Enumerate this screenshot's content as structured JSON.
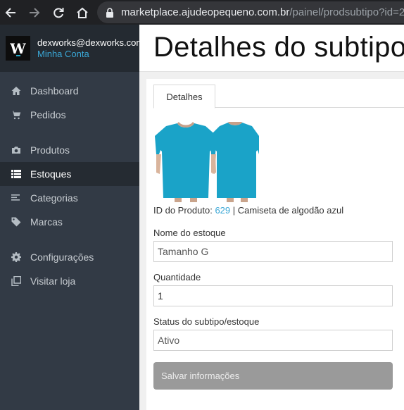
{
  "browser": {
    "url_host": "marketplace.ajudeopequeno.com.br",
    "url_path": "/painel/prodsubtipo?id=2"
  },
  "sidebar": {
    "logo_letter": "W",
    "user_email": "dexworks@dexworks.com",
    "account_link": "Minha Conta",
    "items": [
      {
        "label": "Dashboard",
        "icon": "home-icon",
        "active": false
      },
      {
        "label": "Pedidos",
        "icon": "cart-icon",
        "active": false
      },
      {
        "label": "Produtos",
        "icon": "camera-icon",
        "active": false
      },
      {
        "label": "Estoques",
        "icon": "list-icon",
        "active": true
      },
      {
        "label": "Categorias",
        "icon": "lines-icon",
        "active": false
      },
      {
        "label": "Marcas",
        "icon": "tag-icon",
        "active": false
      },
      {
        "label": "Configurações",
        "icon": "gear-icon",
        "active": false
      },
      {
        "label": "Visitar loja",
        "icon": "external-link-icon",
        "active": false
      }
    ]
  },
  "main": {
    "title": "Detalhes do subtipo",
    "tab_label": "Detalhes",
    "product": {
      "id_label": "ID do Produto:",
      "id_value": "629",
      "separator": "|",
      "name": "Camiseta de algodão azul",
      "shirt_color": "#1aa3c8"
    },
    "form": {
      "stock_name_label": "Nome do estoque",
      "stock_name_value": "Tamanho G",
      "quantity_label": "Quantidade",
      "quantity_value": "1",
      "status_label": "Status do subtipo/estoque",
      "status_value": "Ativo",
      "save_label": "Salvar informações"
    }
  }
}
